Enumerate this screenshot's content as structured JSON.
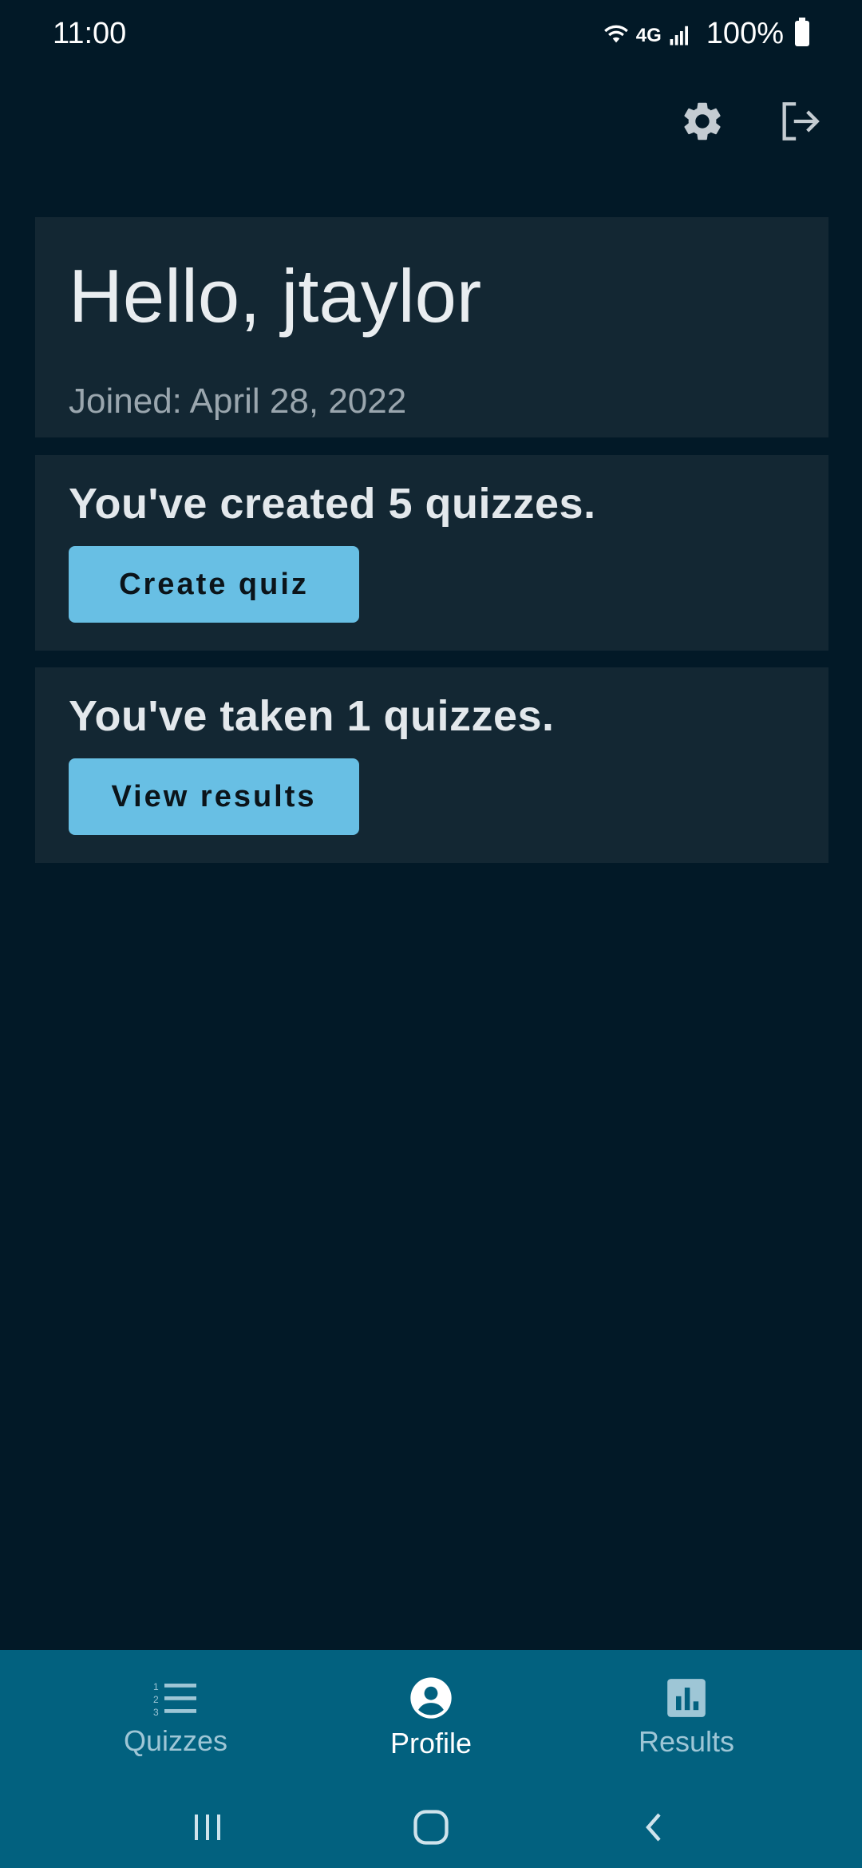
{
  "status_bar": {
    "time": "11:00",
    "network": "4G",
    "battery": "100%"
  },
  "header": {
    "icons": [
      "gear-icon",
      "logout-icon"
    ]
  },
  "profile": {
    "greeting": "Hello, jtaylor",
    "joined": "Joined: April 28, 2022"
  },
  "created": {
    "text": "You've created 5 quizzes.",
    "button_label": "Create quiz"
  },
  "taken": {
    "text": "You've taken 1 quizzes.",
    "button_label": "View results"
  },
  "bottom_nav": {
    "items": [
      {
        "label": "Quizzes",
        "icon": "numbered-list-icon",
        "active": false
      },
      {
        "label": "Profile",
        "icon": "account-circle-icon",
        "active": true
      },
      {
        "label": "Results",
        "icon": "bar-chart-icon",
        "active": false
      }
    ]
  },
  "colors": {
    "background": "#021927",
    "card": "#132733",
    "accent_button": "#68bfe4",
    "nav_bar": "#02617f"
  }
}
